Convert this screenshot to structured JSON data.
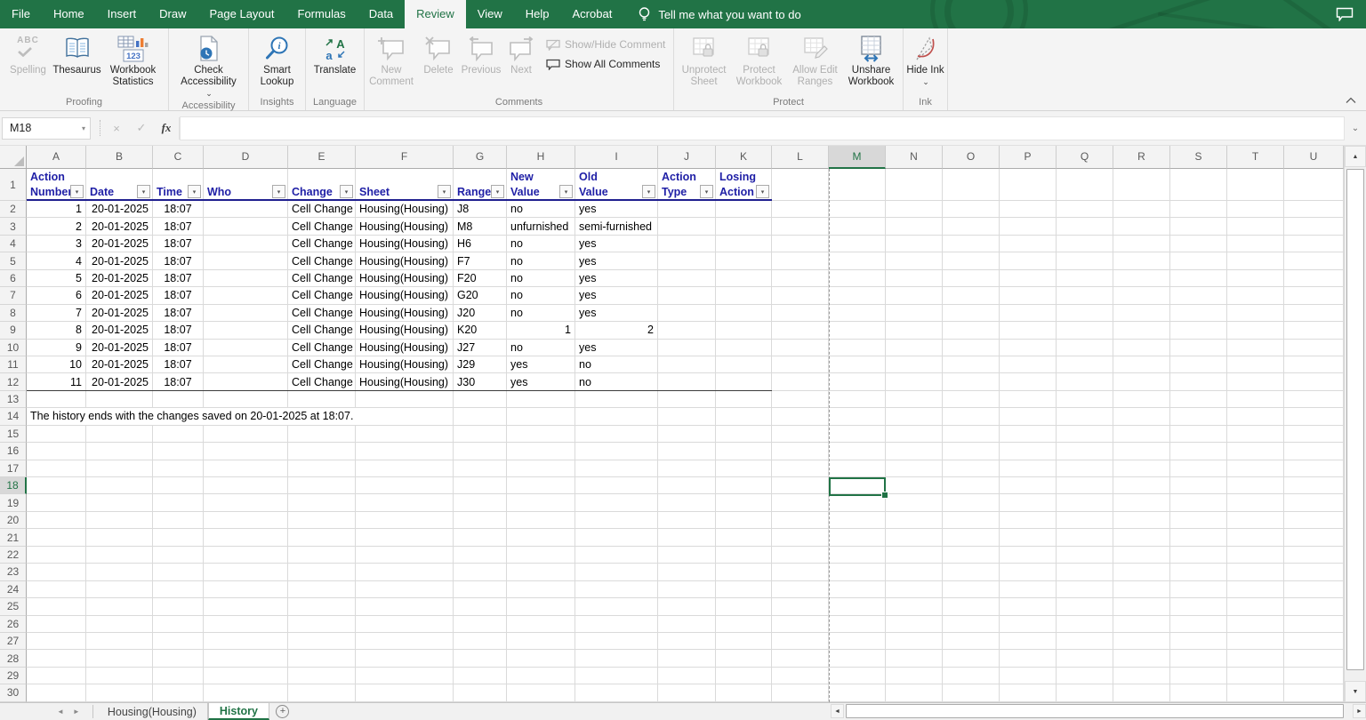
{
  "titlebar": {
    "tabs": [
      "File",
      "Home",
      "Insert",
      "Draw",
      "Page Layout",
      "Formulas",
      "Data",
      "Review",
      "View",
      "Help",
      "Acrobat"
    ],
    "active_tab": "Review",
    "tell_me": "Tell me what you want to do"
  },
  "ribbon": {
    "groups": [
      {
        "label": "Proofing",
        "buttons": [
          {
            "label": "Spelling",
            "disabled": true
          },
          {
            "label": "Thesaurus",
            "disabled": false
          },
          {
            "label": "Workbook Statistics",
            "disabled": false
          }
        ]
      },
      {
        "label": "Accessibility",
        "buttons": [
          {
            "label": "Check Accessibility",
            "disabled": false,
            "dropdown": true
          }
        ]
      },
      {
        "label": "Insights",
        "buttons": [
          {
            "label": "Smart Lookup",
            "disabled": false
          }
        ]
      },
      {
        "label": "Language",
        "buttons": [
          {
            "label": "Translate",
            "disabled": false
          }
        ]
      },
      {
        "label": "Comments",
        "buttons": [
          {
            "label": "New Comment",
            "disabled": true
          },
          {
            "label": "Delete",
            "disabled": true
          },
          {
            "label": "Previous",
            "disabled": true
          },
          {
            "label": "Next",
            "disabled": true
          },
          {
            "label": "Show/Hide Comment",
            "disabled": true
          },
          {
            "label": "Show All Comments",
            "disabled": false
          }
        ]
      },
      {
        "label": "Protect",
        "buttons": [
          {
            "label": "Unprotect Sheet",
            "disabled": true
          },
          {
            "label": "Protect Workbook",
            "disabled": true
          },
          {
            "label": "Allow Edit Ranges",
            "disabled": true
          },
          {
            "label": "Unshare Workbook",
            "disabled": false
          }
        ]
      },
      {
        "label": "Ink",
        "buttons": [
          {
            "label": "Hide Ink",
            "disabled": false,
            "dropdown": true
          }
        ]
      }
    ]
  },
  "formula_bar": {
    "name_box": "M18",
    "formula": ""
  },
  "sheet": {
    "columns": [
      "A",
      "B",
      "C",
      "D",
      "E",
      "F",
      "G",
      "H",
      "I",
      "J",
      "K",
      "L",
      "M",
      "N",
      "O",
      "P",
      "Q",
      "R",
      "S",
      "T",
      "U"
    ],
    "row_count": 30,
    "selection": {
      "cell": "M18",
      "column": "M",
      "row": 18
    },
    "history_table": {
      "headers": [
        [
          "Action",
          "Number"
        ],
        [
          "",
          "Date"
        ],
        [
          "",
          "Time"
        ],
        [
          "",
          "Who"
        ],
        [
          "",
          "Change"
        ],
        [
          "",
          "Sheet"
        ],
        [
          "",
          "Range"
        ],
        [
          "New",
          "Value"
        ],
        [
          "Old",
          "Value"
        ],
        [
          "Action",
          "Type"
        ],
        [
          "Losing",
          "Action"
        ]
      ],
      "rows": [
        [
          "1",
          "20-01-2025",
          "18:07",
          "",
          "Cell Change",
          "Housing(Housing)",
          "J8",
          "no",
          "yes",
          "",
          ""
        ],
        [
          "2",
          "20-01-2025",
          "18:07",
          "",
          "Cell Change",
          "Housing(Housing)",
          "M8",
          "unfurnished",
          "semi-furnished",
          "",
          ""
        ],
        [
          "3",
          "20-01-2025",
          "18:07",
          "",
          "Cell Change",
          "Housing(Housing)",
          "H6",
          "no",
          "yes",
          "",
          ""
        ],
        [
          "4",
          "20-01-2025",
          "18:07",
          "",
          "Cell Change",
          "Housing(Housing)",
          "F7",
          "no",
          "yes",
          "",
          ""
        ],
        [
          "5",
          "20-01-2025",
          "18:07",
          "",
          "Cell Change",
          "Housing(Housing)",
          "F20",
          "no",
          "yes",
          "",
          ""
        ],
        [
          "6",
          "20-01-2025",
          "18:07",
          "",
          "Cell Change",
          "Housing(Housing)",
          "G20",
          "no",
          "yes",
          "",
          ""
        ],
        [
          "7",
          "20-01-2025",
          "18:07",
          "",
          "Cell Change",
          "Housing(Housing)",
          "J20",
          "no",
          "yes",
          "",
          ""
        ],
        [
          "8",
          "20-01-2025",
          "18:07",
          "",
          "Cell Change",
          "Housing(Housing)",
          "K20",
          "1",
          "2",
          "",
          ""
        ],
        [
          "9",
          "20-01-2025",
          "18:07",
          "",
          "Cell Change",
          "Housing(Housing)",
          "J27",
          "no",
          "yes",
          "",
          ""
        ],
        [
          "10",
          "20-01-2025",
          "18:07",
          "",
          "Cell Change",
          "Housing(Housing)",
          "J29",
          "yes",
          "no",
          "",
          ""
        ],
        [
          "11",
          "20-01-2025",
          "18:07",
          "",
          "Cell Change",
          "Housing(Housing)",
          "J30",
          "yes",
          "no",
          "",
          ""
        ]
      ],
      "footer_note": "The history ends with the changes saved on 20-01-2025 at 18:07."
    }
  },
  "sheet_tabs": {
    "tabs": [
      "Housing(Housing)",
      "History"
    ],
    "active": "History"
  },
  "icons": {
    "dropdown": "⌄",
    "dropdown_small": "▾",
    "filter_small": "▾",
    "scroll_up": "▲",
    "scroll_down": "▼",
    "scroll_left": "◄",
    "scroll_right": "►",
    "tab_nav_left": "◄",
    "tab_nav_right": "►",
    "add_sheet": "+",
    "cancel": "×",
    "enter": "✓",
    "function_label": "fx",
    "dots": "⋮⋮"
  },
  "colors": {
    "excel_green": "#217346",
    "header_blue": "#1f1fa6"
  }
}
